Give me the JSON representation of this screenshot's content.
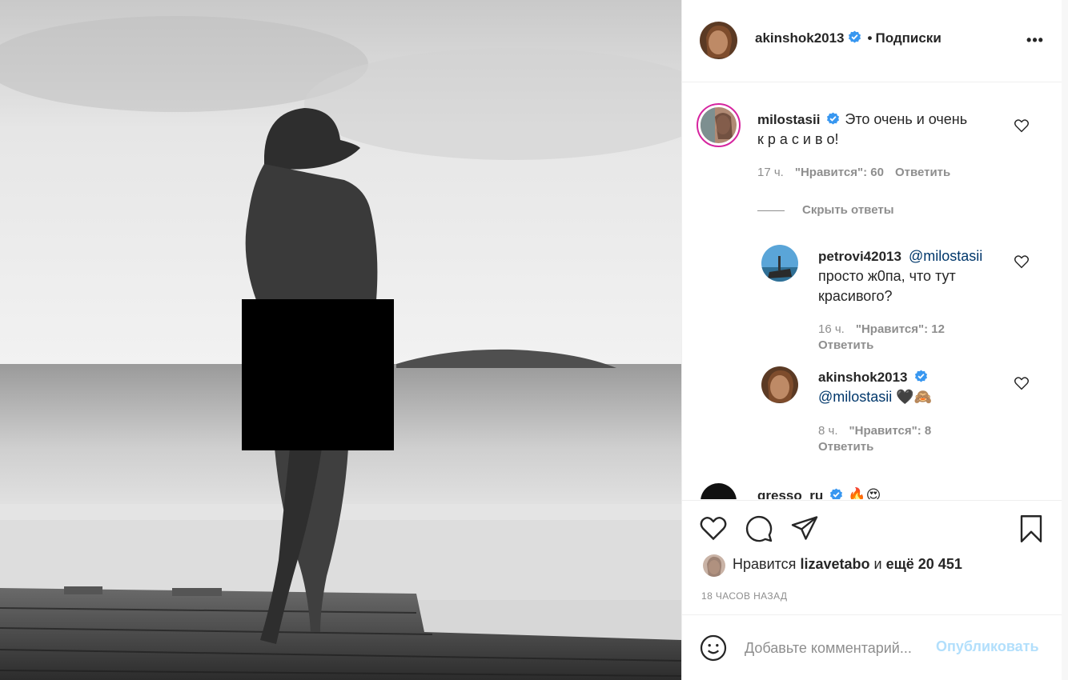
{
  "post": {
    "author": "akinshok2013",
    "separator": "•",
    "follow_status": "Подписки",
    "more_label": "•••"
  },
  "comments": [
    {
      "user": "milostasii",
      "verified": true,
      "text": "Это очень и очень",
      "text_line2": "к р а с и в о!",
      "time": "17 ч.",
      "likes": "\"Нравится\": 60",
      "reply_label": "Ответить",
      "hide_replies": "Скрыть ответы",
      "replies": [
        {
          "user": "petrovi42013",
          "mention": "@milostasii",
          "text_line1": "просто ж0па, что тут",
          "text_line2": "красивого?",
          "time": "16 ч.",
          "likes": "\"Нравится\": 12",
          "reply_label": "Ответить"
        },
        {
          "user": "akinshok2013",
          "verified": true,
          "mention": "@milostasii",
          "emoji": "🖤🙈",
          "time": "8 ч.",
          "likes": "\"Нравится\": 8",
          "reply_label": "Ответить"
        }
      ]
    },
    {
      "user": "gresso_ru",
      "verified": true,
      "emoji": "🔥😍"
    }
  ],
  "likes": {
    "prefix": "Нравится",
    "user": "lizavetabo",
    "middle": "и",
    "rest": "ещё 20 451"
  },
  "time_ago": "18 ЧАСОВ НАЗАД",
  "add_comment": {
    "placeholder": "Добавьте комментарий...",
    "publish_label": "Опубликовать"
  },
  "icons": {
    "like": "heart-icon",
    "comment": "comment-icon",
    "share": "paper-plane-icon",
    "save": "bookmark-icon",
    "emoji": "smiley-icon",
    "more": "more-icon",
    "verified": "verified-badge-icon"
  },
  "colors": {
    "text": "#262626",
    "muted": "#8e8e8e",
    "mention": "#00376b",
    "verified": "#3897f0",
    "publish_disabled": "#b2dffc",
    "story_ring": "#d6249f"
  }
}
